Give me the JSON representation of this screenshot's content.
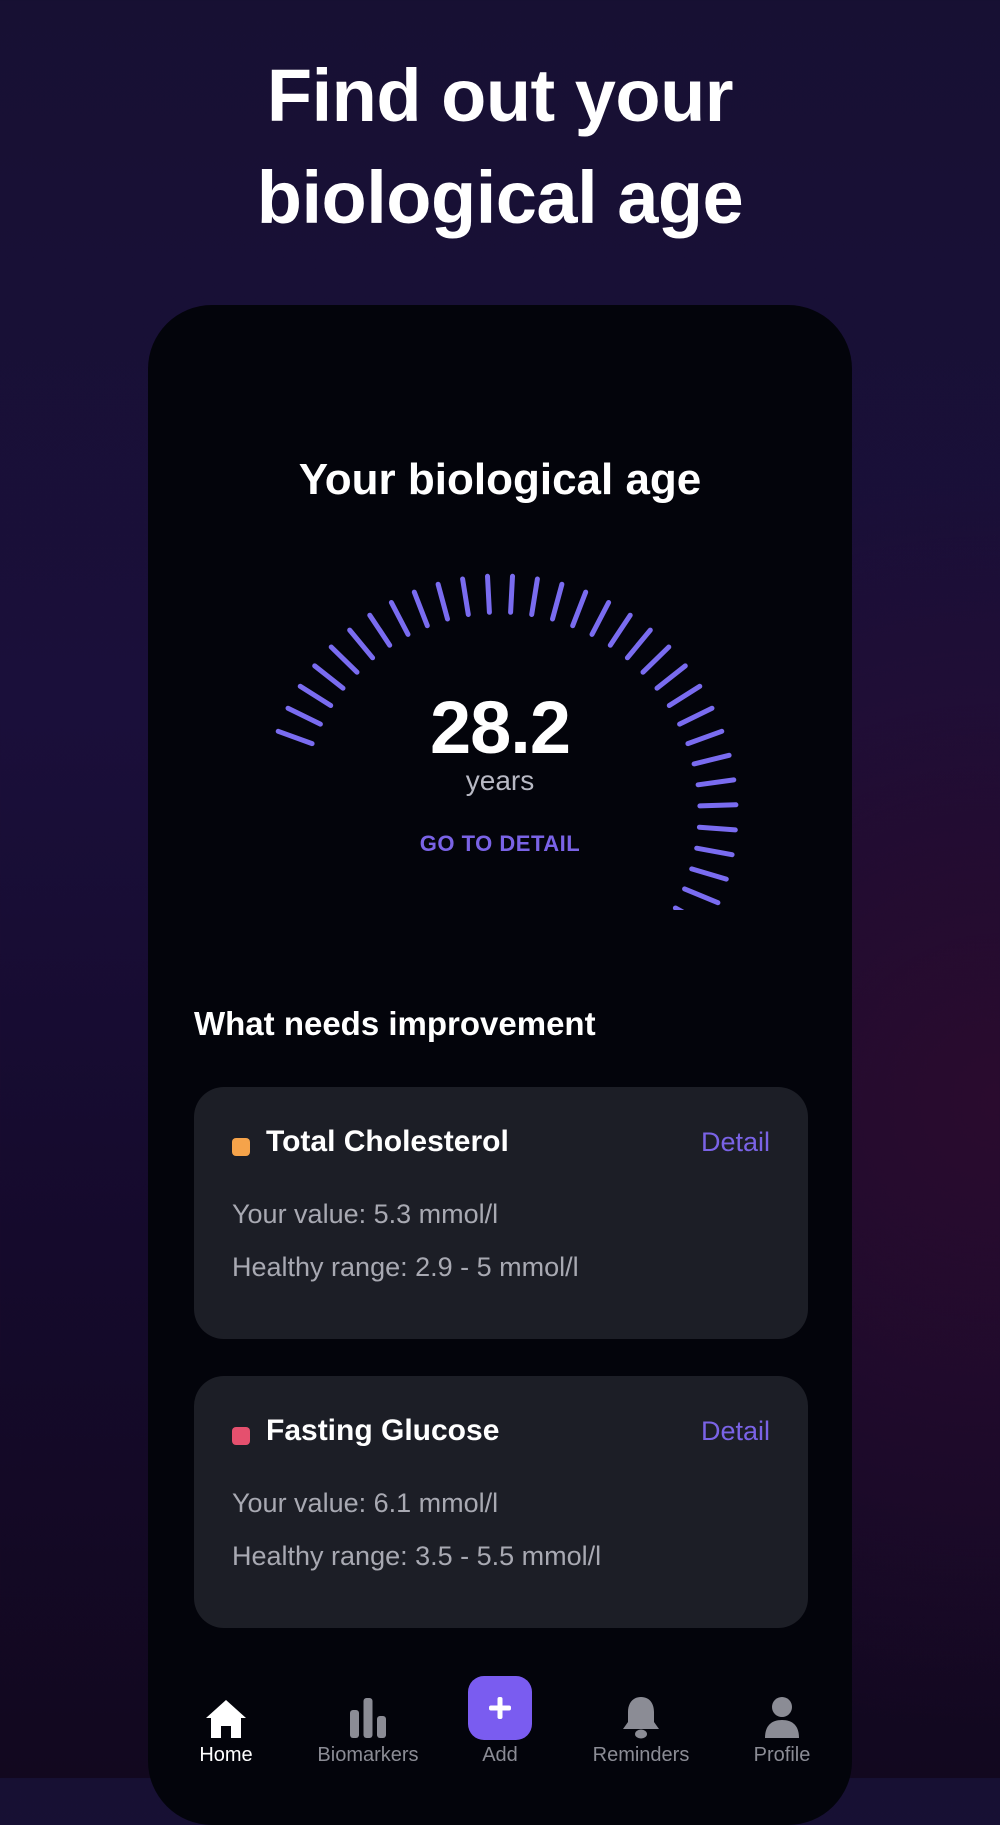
{
  "hero": {
    "line1": "Find out your",
    "line2": "biological age"
  },
  "card_title": "Your biological age",
  "gauge": {
    "value": "28.2",
    "unit": "years",
    "link": "GO TO DETAIL",
    "accent": "#7a6cf0"
  },
  "section_title": "What needs improvement",
  "items": [
    {
      "name": "Total Cholesterol",
      "color": "#f5a34a",
      "link": "Detail",
      "value_line": "Your value: 5.3 mmol/l",
      "range_line": "Healthy range: 2.9 - 5 mmol/l"
    },
    {
      "name": "Fasting Glucose",
      "color": "#e5506e",
      "link": "Detail",
      "value_line": "Your value: 6.1 mmol/l",
      "range_line": "Healthy range: 3.5 - 5.5 mmol/l"
    }
  ],
  "tabbar": [
    {
      "label": "Home",
      "icon": "home-icon",
      "active": true
    },
    {
      "label": "Biomarkers",
      "icon": "bar-chart-icon",
      "active": false
    },
    {
      "label": "Add",
      "icon": "plus-icon",
      "active": false
    },
    {
      "label": "Reminders",
      "icon": "bell-icon",
      "active": false
    },
    {
      "label": "Profile",
      "icon": "user-icon",
      "active": false
    }
  ]
}
